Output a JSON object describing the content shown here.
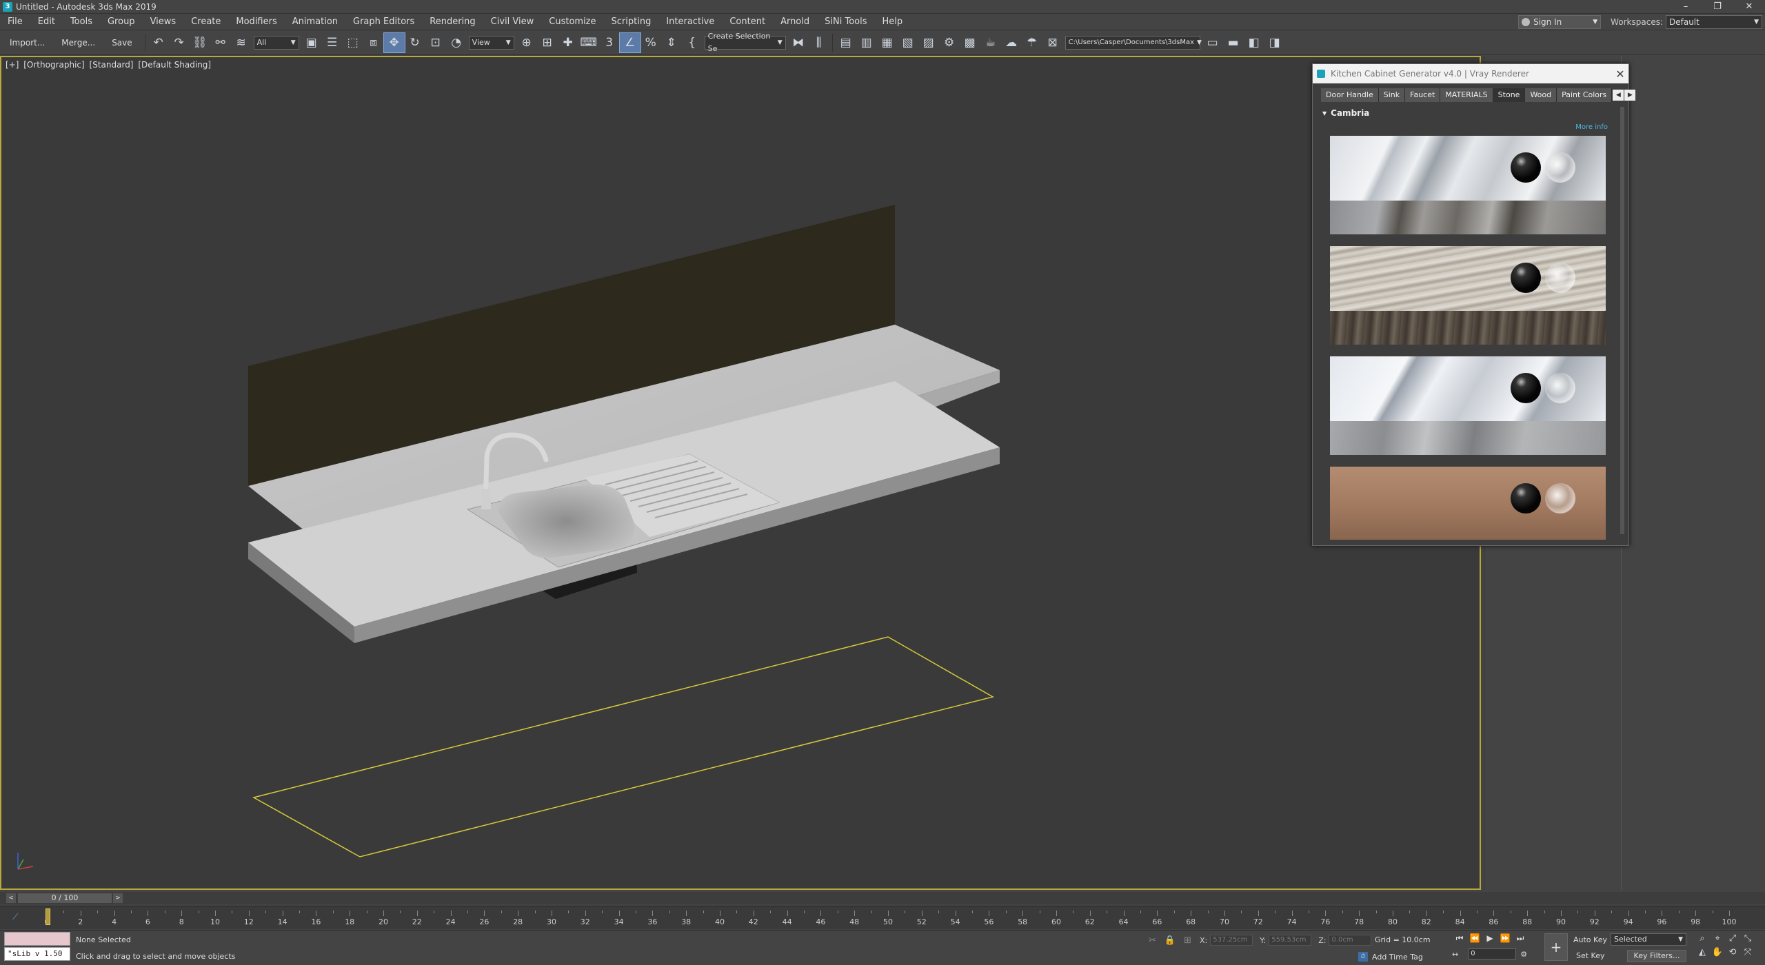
{
  "window": {
    "title": "Untitled - Autodesk 3ds Max 2019",
    "app_icon": "3",
    "controls": [
      "–",
      "❐",
      "✕"
    ]
  },
  "menu": {
    "items": [
      "File",
      "Edit",
      "Tools",
      "Group",
      "Views",
      "Create",
      "Modifiers",
      "Animation",
      "Graph Editors",
      "Rendering",
      "Civil View",
      "Customize",
      "Scripting",
      "Interactive",
      "Content",
      "Arnold",
      "SiNi Tools",
      "Help"
    ],
    "sign_in": "Sign In",
    "workspaces_label": "Workspaces:",
    "workspace_value": "Default"
  },
  "toolbar": {
    "import": "Import...",
    "merge": "Merge...",
    "save": "Save",
    "filter_value": "All",
    "refcoord_value": "View",
    "selection_set_value": "Create Selection Se",
    "project_path": "C:\\Users\\Casper\\Documents\\3dsMax"
  },
  "viewport": {
    "label_parts": [
      "[+]",
      "[Orthographic]",
      "[Standard]",
      "[Default Shading]"
    ],
    "accent": "#b8a938"
  },
  "plugin": {
    "title": "Kitchen Cabinet Generator v4.0 | Vray Renderer",
    "close": "✕",
    "tabs": [
      {
        "label": "Door Handle"
      },
      {
        "label": "Sink"
      },
      {
        "label": "Faucet"
      },
      {
        "label": "MATERIALS"
      },
      {
        "label": "Stone"
      },
      {
        "label": "Wood"
      },
      {
        "label": "Paint Colors"
      }
    ],
    "selected_tab": "Stone",
    "section_title": "Cambria",
    "more_info": "More info",
    "materials": [
      {
        "top": "linear-gradient(115deg,#d9dde2 0%,#f2f3f5 20%,#b9bfc6 23%,#eef0f2 32%,#9aa1a8 38%,#e6e9ec 48%,#c5c9ce 60%,#f1f2f4 74%,#9ea3a9 82%,#e8ebee 100%)",
        "bottom": "linear-gradient(100deg,#8c8d90 0%,#a9aaad 18%,#55514c 26%,#9d9b98 34%,#6c6864 46%,#b0afac 58%,#4c4844 66%,#9b9a97 78%,#727170 100%)"
      },
      {
        "top": "repeating-linear-gradient(170deg,#cbc6bd 0px,#e2ddd4 6px,#a9a298 11px,#d8d2c8 16px,#b8b1a6 22px)",
        "bottom": "repeating-linear-gradient(95deg,#5a5148 0px,#3f3730 9px,#6e6458 17px,#4a4138 26px)"
      },
      {
        "top": "linear-gradient(120deg,#e3e7ed 0%,#f5f7f9 25%,#9aa1ab 28%,#eef1f5 38%,#c7ccd3 52%,#f3f5f8 70%,#a4aab2 76%,#e9ecf0 100%)",
        "bottom": "linear-gradient(100deg,#a7a9ac 0%,#8b8d90 20%,#c1c2c4 35%,#7d7f82 52%,#b4b5b7 70%,#96989b 100%)"
      },
      {
        "top": "linear-gradient(180deg,#b48c72 0%,#a27a60 60%,#8f6a52 100%)",
        "bottom": "linear-gradient(180deg,#8f6a52 0%,#7a5a45 100%)"
      }
    ]
  },
  "timeline": {
    "frame_display": "0 / 100",
    "prev": "<",
    "next": ">",
    "ruler_numbers": [
      0,
      2,
      4,
      6,
      8,
      10,
      12,
      14,
      16,
      18,
      20,
      22,
      24,
      26,
      28,
      30,
      32,
      34,
      36,
      38,
      40,
      42,
      44,
      46,
      48,
      50,
      52,
      54,
      56,
      58,
      60,
      62,
      64,
      66,
      68,
      70,
      72,
      74,
      76,
      78,
      80,
      82,
      84,
      86,
      88,
      90,
      92,
      94,
      96,
      98,
      100
    ]
  },
  "status": {
    "maxlib": "\"sLib v 1.50",
    "selection": "None Selected",
    "prompt": "Click and drag to select and move objects",
    "x_label": "X:",
    "x_value": "537.25cm",
    "y_label": "Y:",
    "y_value": "559.53cm",
    "z_label": "Z:",
    "z_value": "0.0cm",
    "grid": "Grid = 10.0cm",
    "add_time_tag": "Add Time Tag",
    "auto_key": "Auto Key",
    "set_key": "Set Key",
    "selected_value": "Selected",
    "key_filters": "Key Filters...",
    "current_frame": "0"
  }
}
